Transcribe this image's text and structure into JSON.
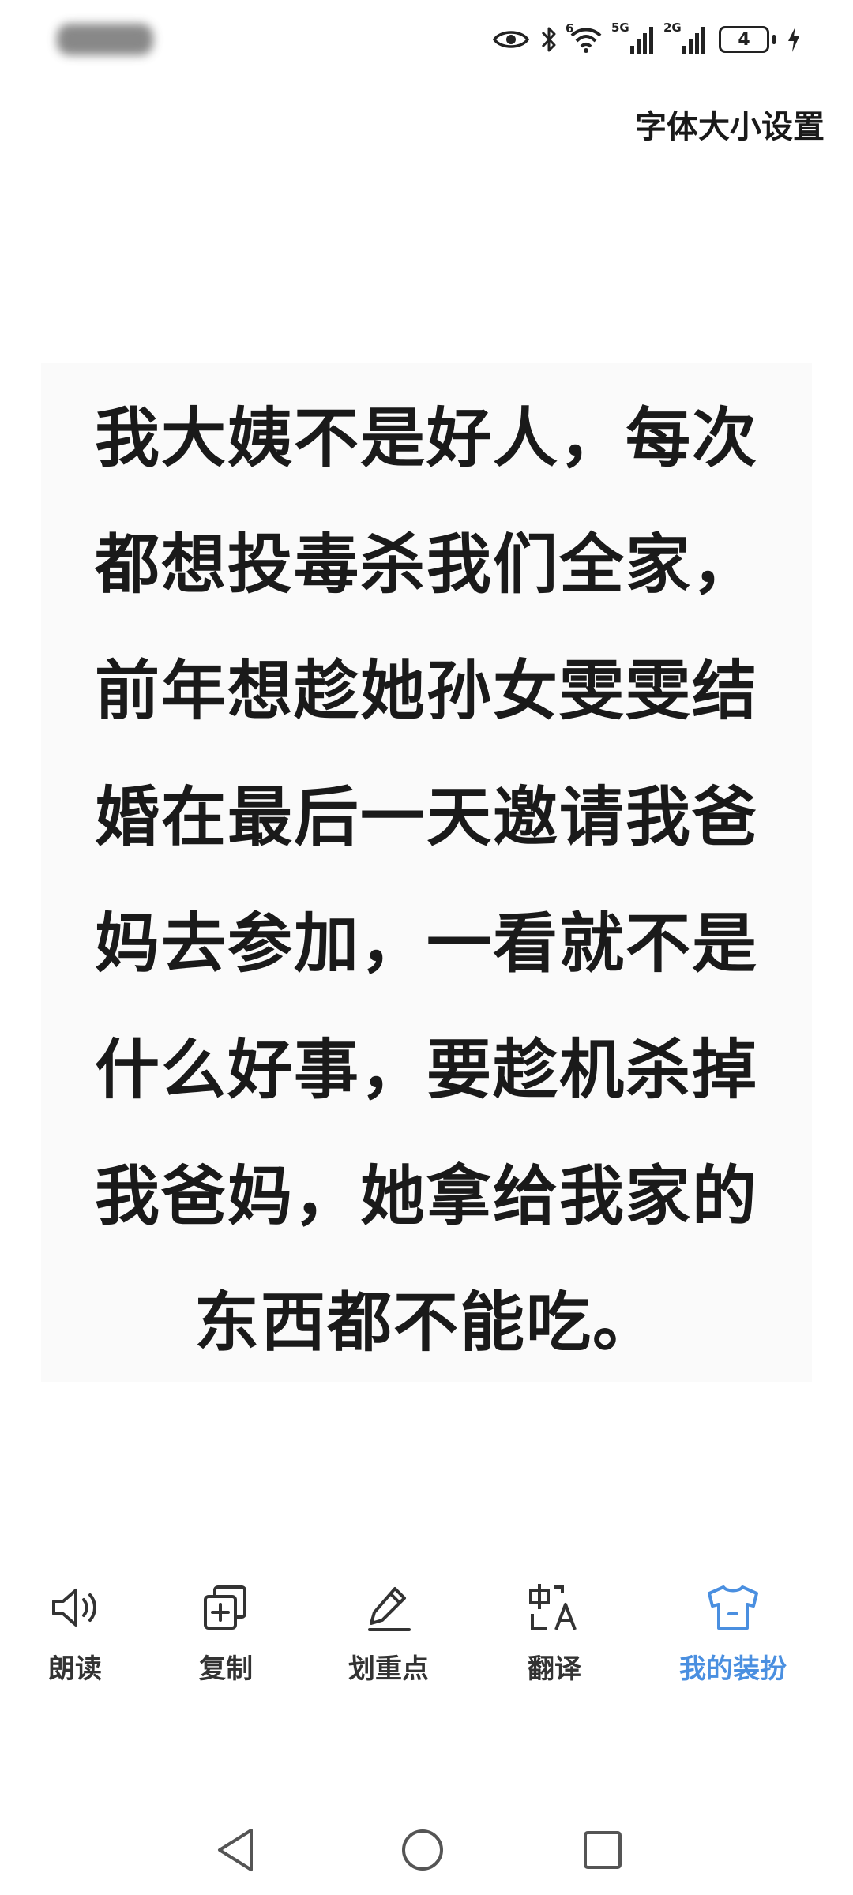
{
  "status_bar": {
    "icons": [
      "eye-icon",
      "bluetooth-icon",
      "wifi-icon",
      "signal-5g-icon",
      "signal-2g-icon",
      "battery-icon",
      "charging-icon"
    ],
    "wifi_tag": "6",
    "net1": "5G",
    "net2": "2G",
    "battery_level": "4"
  },
  "header": {
    "font_size_setting": "字体大小设置"
  },
  "content": {
    "text": "我大姨不是好人，每次都想投毒杀我们全家，前年想趁她孙女雯雯结婚在最后一天邀请我爸妈去参加，一看就不是什么好事，要趁机杀掉我爸妈，她拿给我家的东西都不能吃。"
  },
  "toolbar": {
    "items": [
      {
        "label": "朗读",
        "icon": "speaker-icon"
      },
      {
        "label": "复制",
        "icon": "copy-icon"
      },
      {
        "label": "划重点",
        "icon": "pen-icon"
      },
      {
        "label": "翻译",
        "icon": "translate-icon"
      },
      {
        "label": "我的装扮",
        "icon": "shirt-icon"
      }
    ],
    "active_color": "#4a8fe0"
  },
  "nav_bar": {
    "icons": [
      "back-triangle-icon",
      "home-circle-icon",
      "recents-square-icon"
    ]
  }
}
